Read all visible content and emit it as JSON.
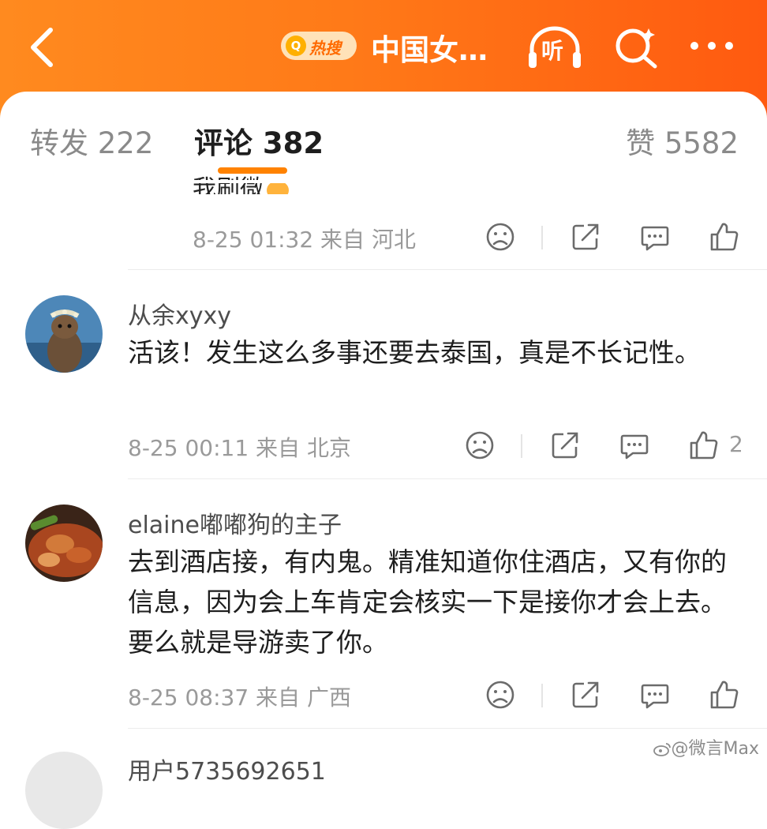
{
  "header": {
    "back_icon": "chevron-left-icon",
    "hot_badge_label": "热搜",
    "hot_badge_search_icon": "Q",
    "title": "中国女…",
    "listen_label": "听",
    "colors": {
      "bar_start": "#ff8a1f",
      "bar_end": "#ff5a10",
      "accent": "#ff8200"
    }
  },
  "tabs": {
    "repost": "转发 222",
    "comment": "评论 382",
    "like": "赞 5582"
  },
  "comments": [
    {
      "clipped_text": "我刷微",
      "meta": "8-25 01:32 来自 河北"
    },
    {
      "username": "从余xyxy",
      "content": "活该！发生这么多事还要去泰国，真是不长记性。",
      "meta": "8-25 00:11 来自 北京",
      "like_count": "2"
    },
    {
      "username": "elaine嘟嘟狗的主子",
      "content": "去到酒店接，有内鬼。精准知道你住酒店，又有你的信息，因为会上车肯定会核实一下是接你才会上去。要么就是导游卖了你。",
      "meta": "8-25 08:37 来自 广西"
    },
    {
      "username": "用户5735692651"
    }
  ],
  "watermark": "@微言Max"
}
